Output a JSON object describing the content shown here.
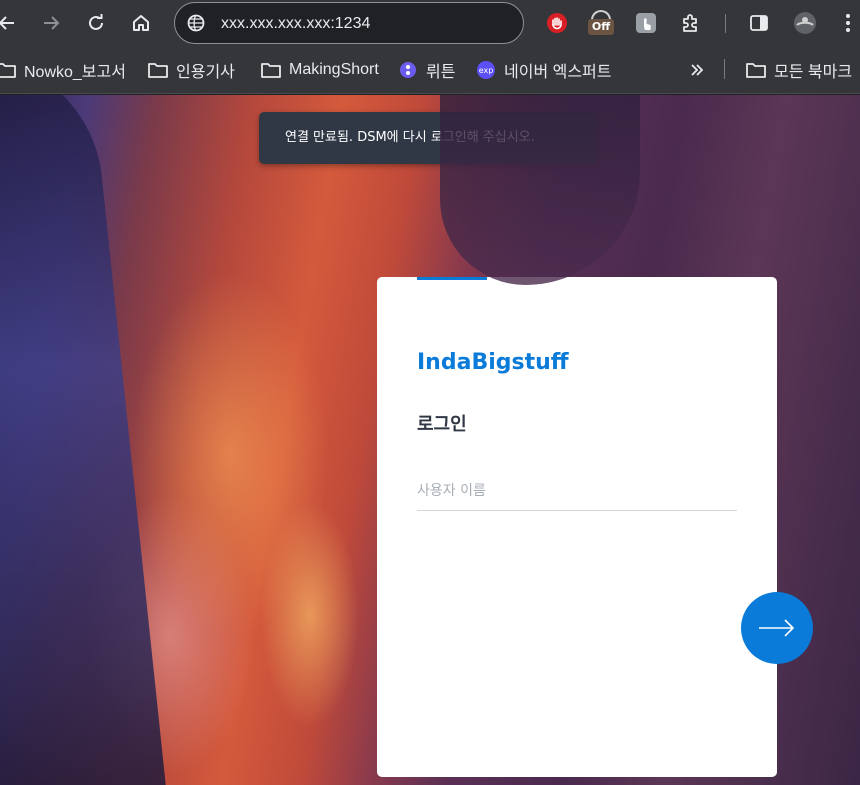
{
  "browser": {
    "url": "xxx.xxx.xxx.xxx:1234",
    "extensions": {
      "off_badge": "Off"
    },
    "bookmarks": [
      {
        "label": "Nowko_보고서",
        "icon": "folder-icon"
      },
      {
        "label": "인용기사",
        "icon": "folder-icon"
      },
      {
        "label": "MakingShort",
        "icon": "folder-icon"
      },
      {
        "label": "뤼튼",
        "icon": "wrtn-icon"
      },
      {
        "label": "네이버 엑스퍼트",
        "icon": "naver-expert-icon"
      }
    ],
    "all_bookmarks": "모든 북마크"
  },
  "page": {
    "toast_message": "연결 만료됨. DSM에 다시 로그인해 주십시오.",
    "login": {
      "brand": "IndaBigstuff",
      "heading": "로그인",
      "username_placeholder": "사용자 이름",
      "username_value": ""
    }
  },
  "colors": {
    "accent": "#0a7bd8",
    "toast_bg": "#303846",
    "chrome_bg": "#35363a"
  }
}
